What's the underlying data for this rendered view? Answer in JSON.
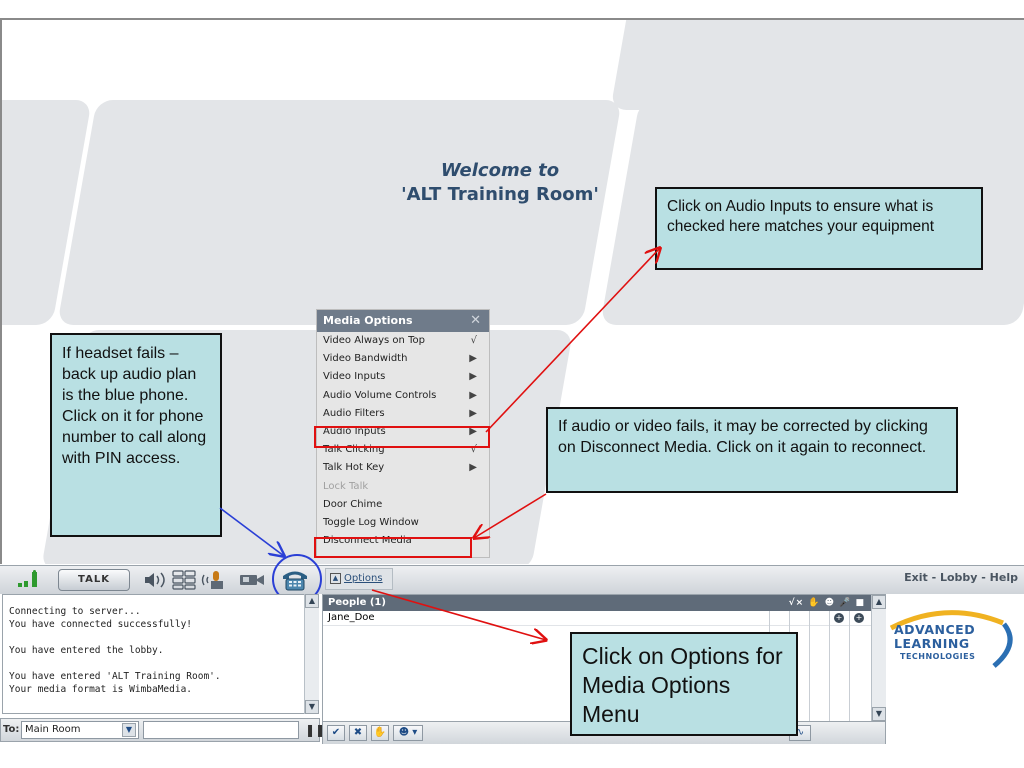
{
  "welcome": {
    "line1": "Welcome to",
    "line2": "'ALT Training Room'"
  },
  "media_menu": {
    "title": "Media Options",
    "close": "✕",
    "items": [
      {
        "label": "Video Always on Top",
        "mark": "√"
      },
      {
        "label": "Video Bandwidth",
        "mark": "▶"
      },
      {
        "label": "Video Inputs",
        "mark": "▶"
      },
      {
        "label": "Audio Volume Controls",
        "mark": "▶"
      },
      {
        "label": "Audio Filters",
        "mark": "▶"
      },
      {
        "label": "Audio Inputs",
        "mark": "▶"
      },
      {
        "label": "Talk Clicking",
        "mark": "√"
      },
      {
        "label": "Talk Hot Key",
        "mark": "▶"
      },
      {
        "label": "Lock Talk",
        "mark": ""
      },
      {
        "label": "Door Chime",
        "mark": ""
      },
      {
        "label": "Toggle Log Window",
        "mark": ""
      },
      {
        "label": "Disconnect Media",
        "mark": ""
      }
    ]
  },
  "callouts": {
    "audio_inputs": "Click on Audio Inputs to ensure what is checked here matches your equipment",
    "headset": "If headset fails – back up audio plan is the blue phone.  Click on it for phone number to call along with PIN access.",
    "disconnect": "If audio or video fails, it may be corrected by clicking on Disconnect Media.  Click on it again to reconnect.",
    "options": "Click on Options for Media Options Menu"
  },
  "toolbar": {
    "talk_label": "TALK",
    "options_label": "Options",
    "nav_links": "Exit - Lobby - Help"
  },
  "log": {
    "lines": [
      "Connecting to server...",
      "You have connected successfully!",
      "",
      "You have entered the lobby.",
      "",
      "You have entered 'ALT Training Room'.",
      "Your media format is WimbaMedia."
    ]
  },
  "chat": {
    "to_label": "To:",
    "room": "Main Room"
  },
  "people": {
    "header": "People (1)",
    "header_icons": "√×  ✋  ☻  🎤  ■",
    "rows": [
      "Jane_Doe"
    ]
  },
  "logo": {
    "line1": "ADVANCED",
    "line2": "LEARNING",
    "line3": "TECHNOLOGIES"
  },
  "colors": {
    "callout_fill": "#b9e0e3",
    "arrow_red": "#e01010",
    "arrow_blue": "#2a3fd6",
    "menu_header": "#6f7b8a"
  }
}
